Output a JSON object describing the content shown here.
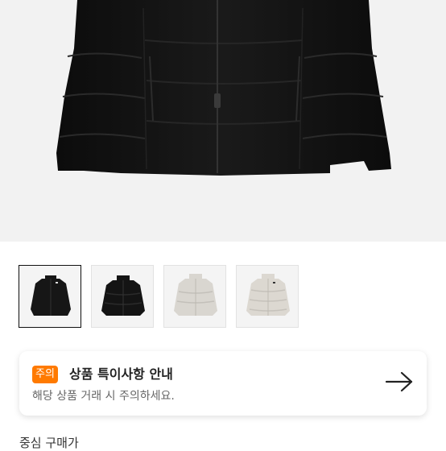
{
  "product": {
    "main_image": "black-puffer-jacket",
    "thumbnails": [
      {
        "name": "black-jacket-front"
      },
      {
        "name": "black-jacket-puffer"
      },
      {
        "name": "cream-jacket-front"
      },
      {
        "name": "cream-jacket-puffer"
      }
    ],
    "active_thumbnail": 0
  },
  "notice": {
    "badge": "주의",
    "title": "상품 특이사항 안내",
    "description": "해당 상품 거래 시 주의하세요.",
    "arrow_icon": "arrow-right-icon",
    "badge_color": "#ff7a00"
  },
  "next_section": {
    "label": "중심 구매가"
  }
}
